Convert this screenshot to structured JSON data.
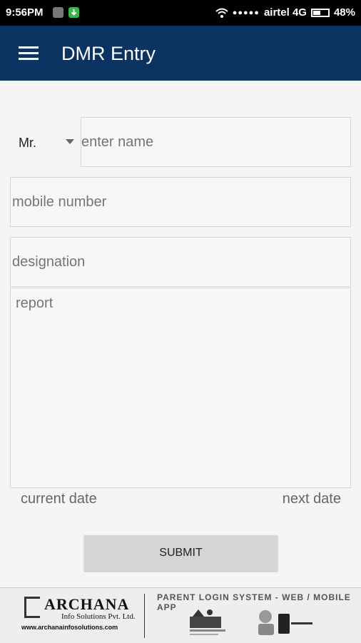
{
  "status_bar": {
    "time": "9:56PM",
    "carrier": "airtel 4G",
    "battery": "48%",
    "signal_dots": "●●●●●",
    "icons": [
      "notification-icon",
      "download-icon",
      "wifi-icon",
      "signal-icon",
      "battery-icon"
    ]
  },
  "app_bar": {
    "title": "DMR Entry",
    "menu_icon": "hamburger-menu-icon",
    "color": "#0b3362"
  },
  "form": {
    "salutation": {
      "value": "Mr."
    },
    "name": {
      "placeholder": "enter name",
      "value": ""
    },
    "mobile": {
      "placeholder": "mobile number",
      "value": ""
    },
    "designation": {
      "placeholder": "designation",
      "value": ""
    },
    "report": {
      "placeholder": "report",
      "value": ""
    },
    "current_date_label": "current date",
    "next_date_label": "next date",
    "submit_label": "SUBMIT"
  },
  "ad_banner": {
    "brand": "ARCHANA",
    "brand_sub": "Info Solutions Pvt. Ltd.",
    "url": "www.archanainfosolutions.com",
    "headline": "PARENT LOGIN SYSTEM -  WEB / MOBILE APP",
    "product_icon": "parent-login-logo-icon",
    "devices_icon": "mobile-devices-icon"
  }
}
